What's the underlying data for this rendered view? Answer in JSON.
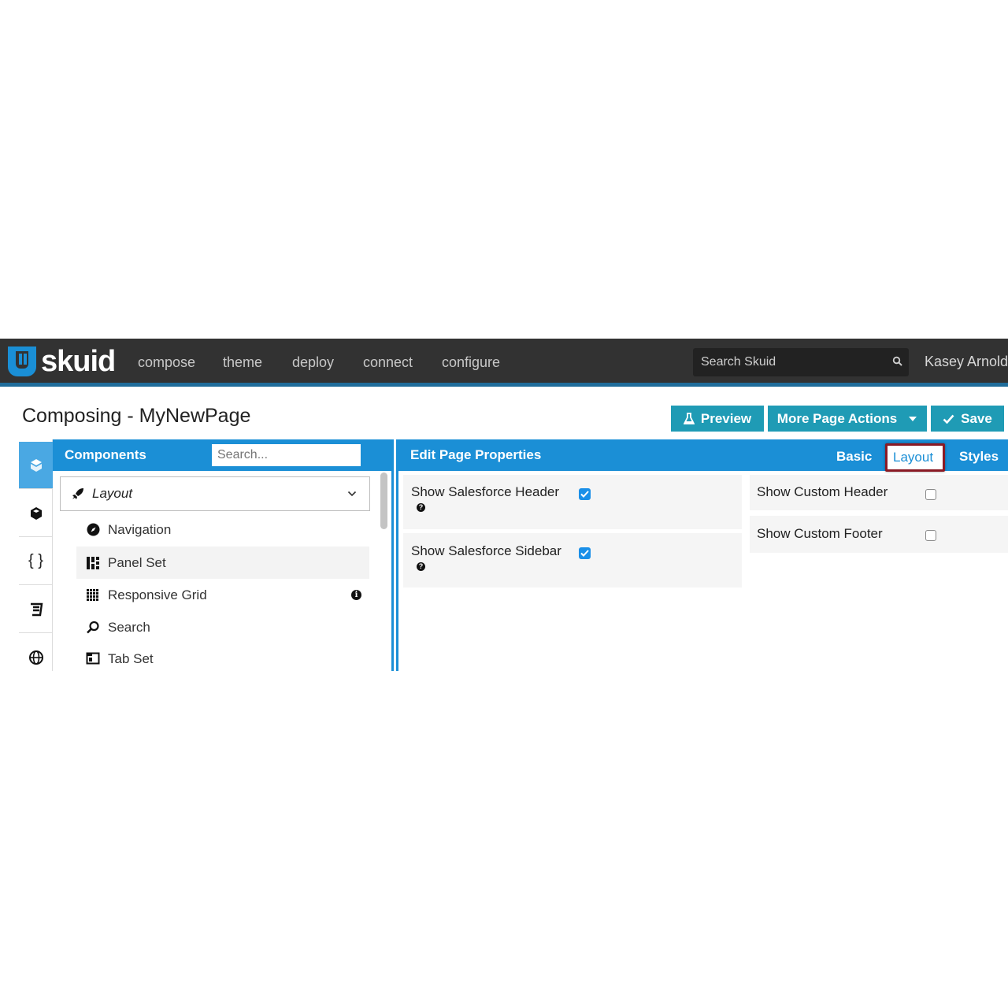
{
  "app": {
    "logo_text": "skuid",
    "nav": [
      "compose",
      "theme",
      "deploy",
      "connect",
      "configure"
    ],
    "search_placeholder": "Search Skuid",
    "user_name": "Kasey Arnold-I"
  },
  "page": {
    "title": "Composing - MyNewPage",
    "buttons": {
      "preview": "Preview",
      "more_actions": "More Page Actions",
      "save": "Save"
    }
  },
  "components_panel": {
    "title": "Components",
    "search_placeholder": "Search...",
    "group": "Layout",
    "items": [
      "Navigation",
      "Panel Set",
      "Responsive Grid",
      "Search",
      "Tab Set"
    ],
    "rail_icons": [
      "cube-stack-icon",
      "cube-icon",
      "braces-icon",
      "css-icon",
      "globe-icon"
    ]
  },
  "properties_panel": {
    "title": "Edit Page Properties",
    "tabs": [
      "Basic",
      "Layout",
      "Styles"
    ],
    "active_tab": "Layout",
    "left_props": [
      {
        "label": "Show Salesforce Header",
        "checked": true
      },
      {
        "label": "Show Salesforce Sidebar",
        "checked": true
      }
    ],
    "right_props": [
      {
        "label": "Show Custom Header",
        "checked": false
      },
      {
        "label": "Show Custom Footer",
        "checked": false
      }
    ]
  },
  "colors": {
    "accent": "#1b8fd6",
    "button": "#1f9bb5",
    "topbar": "#323232",
    "highlight": "#8a1a25"
  }
}
